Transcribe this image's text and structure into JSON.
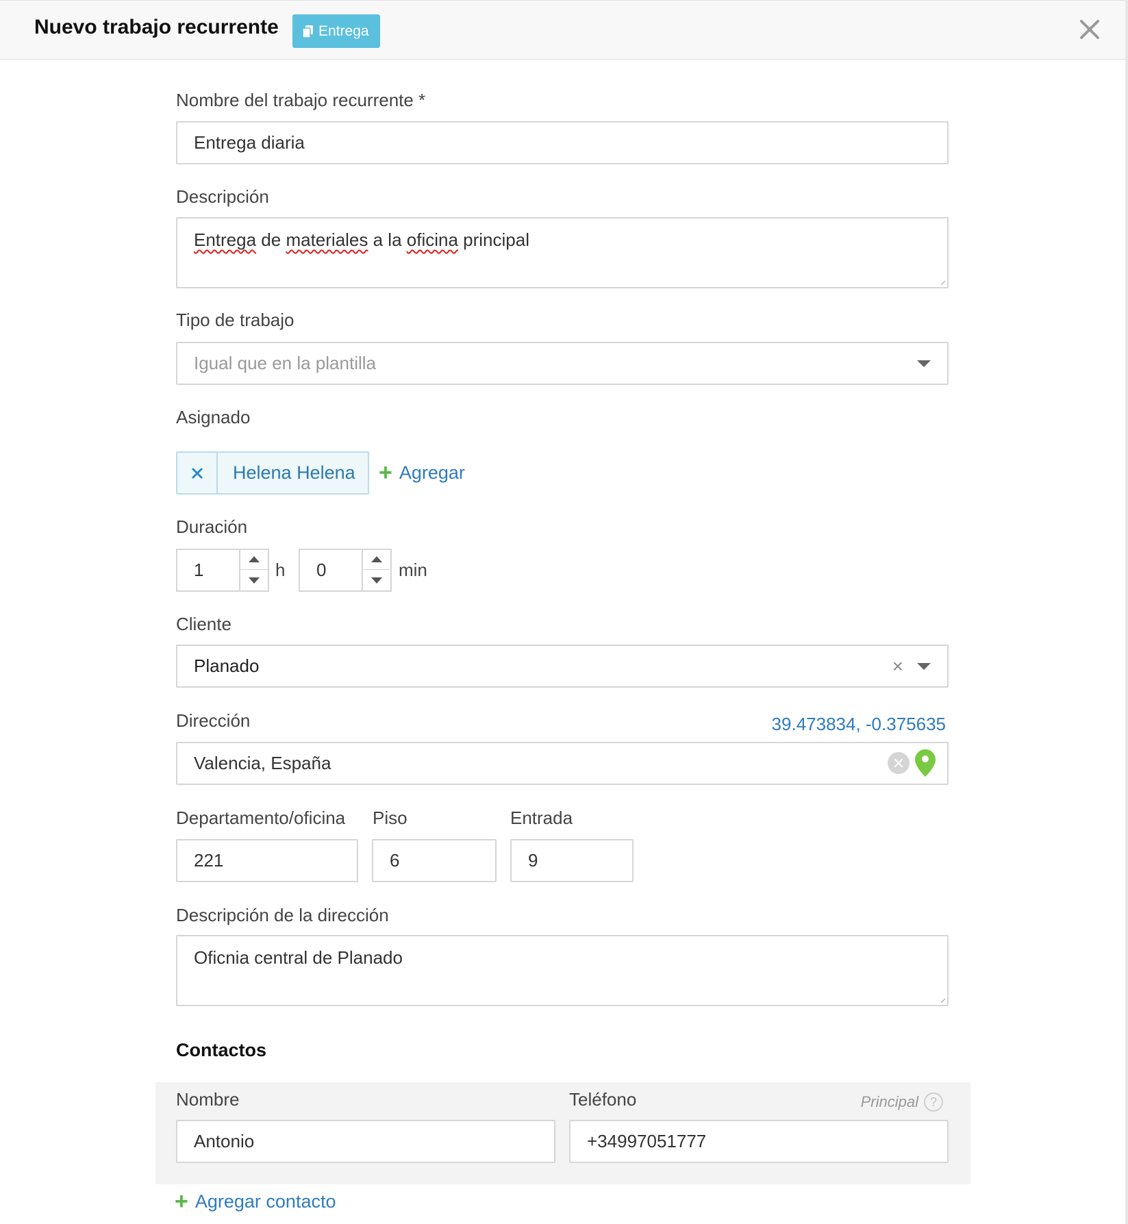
{
  "header": {
    "title": "Nuevo trabajo recurrente",
    "badge_label": "Entrega",
    "close_icon": "close-icon"
  },
  "form": {
    "name": {
      "label": "Nombre del trabajo recurrente *",
      "value": "Entrega diaria"
    },
    "description": {
      "label": "Descripción",
      "value_parts": [
        "Entrega",
        " de ",
        "materiales",
        " a la ",
        "oficina",
        " principal"
      ]
    },
    "job_type": {
      "label": "Tipo de trabajo",
      "placeholder": "Igual que en la plantilla"
    },
    "assigned": {
      "label": "Asignado",
      "assignees": [
        "Helena Helena"
      ],
      "add_label": "Agregar"
    },
    "duration": {
      "label": "Duración",
      "hours": "1",
      "hours_unit": "h",
      "minutes": "0",
      "minutes_unit": "min"
    },
    "client": {
      "label": "Cliente",
      "value": "Planado",
      "clear_symbol": "×"
    },
    "address": {
      "label": "Dirección",
      "coordinates": "39.473834, -0.375635",
      "value": "Valencia, España",
      "pin_color": "#7ac943"
    },
    "department": {
      "label": "Departamento/oficina",
      "value": "221"
    },
    "floor": {
      "label": "Piso",
      "value": "6"
    },
    "entrance": {
      "label": "Entrada",
      "value": "9"
    },
    "address_description": {
      "label": "Descripción de la dirección",
      "value": "Oficnia central de Planado"
    }
  },
  "contacts": {
    "title": "Contactos",
    "name_label": "Nombre",
    "phone_label": "Teléfono",
    "principal_label": "Principal",
    "help_symbol": "?",
    "items": [
      {
        "name": "Antonio",
        "phone": "+34997051777"
      }
    ],
    "add_label": "Agregar contacto"
  },
  "colors": {
    "badge": "#5bc0de",
    "link": "#2f7bbf",
    "plus": "#58b947"
  }
}
